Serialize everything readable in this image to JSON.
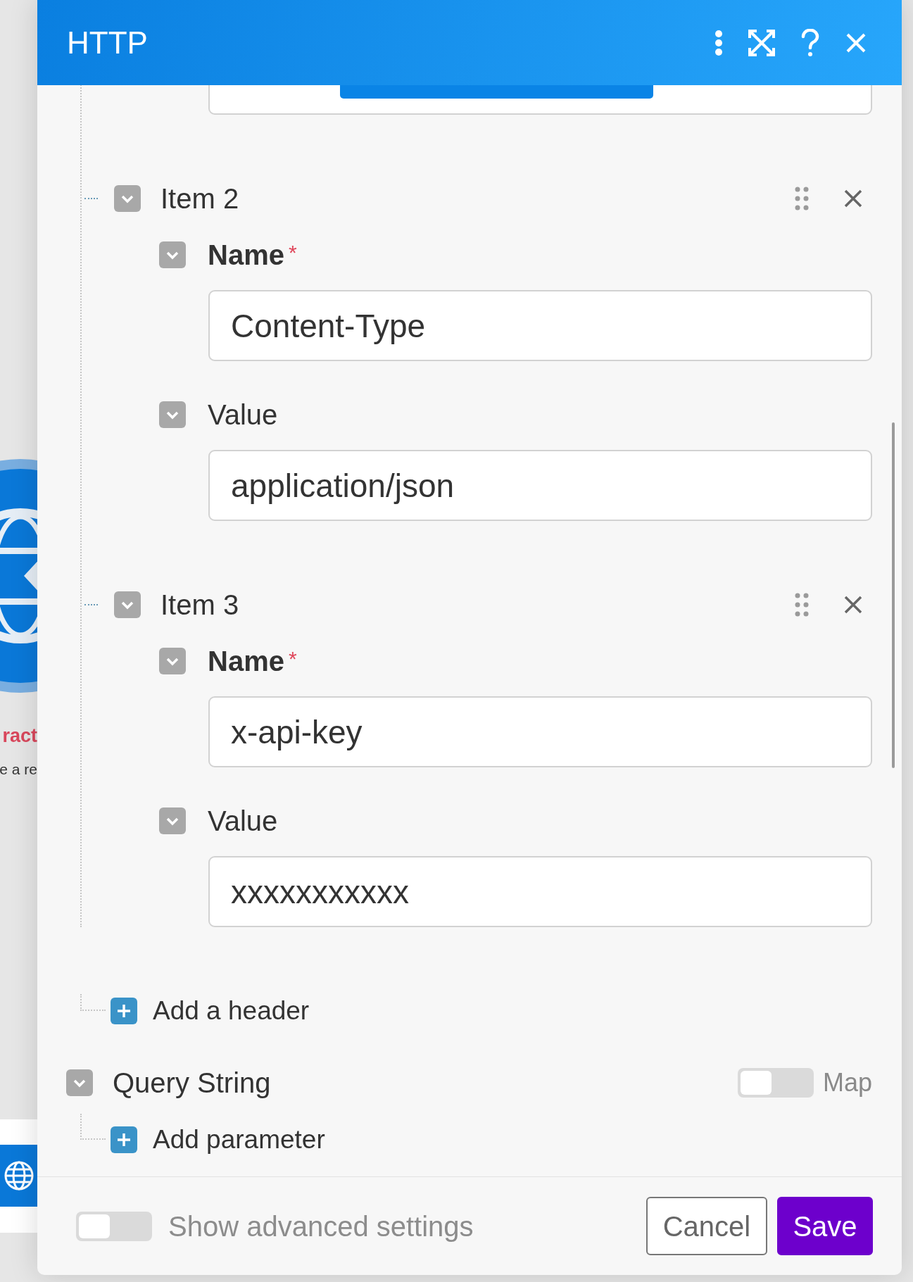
{
  "window": {
    "title": "HTTP"
  },
  "background": {
    "module_title": "ract",
    "module_subtitle": "e a re"
  },
  "headers": {
    "items": [
      {
        "title": "Item 2",
        "expanded": true,
        "fields": [
          {
            "label": "Name",
            "required_mark": "*",
            "expanded": true,
            "value": "Content-Type"
          },
          {
            "label": "Value",
            "expanded": true,
            "value": "application/json"
          }
        ]
      },
      {
        "title": "Item 3",
        "expanded": true,
        "fields": [
          {
            "label": "Name",
            "required_mark": "*",
            "expanded": true,
            "value": "x-api-key"
          },
          {
            "label": "Value",
            "expanded": true,
            "value": "xxxxxxxxxxx"
          }
        ]
      }
    ],
    "add_label": "Add a header"
  },
  "query_string": {
    "title": "Query String",
    "expanded": true,
    "map": {
      "label": "Map",
      "on": false
    },
    "add_label": "Add parameter"
  },
  "footer": {
    "advanced": {
      "label": "Show advanced settings",
      "on": false
    },
    "buttons": [
      {
        "label": "Cancel",
        "kind": "secondary"
      },
      {
        "label": "Save",
        "kind": "primary"
      }
    ]
  }
}
